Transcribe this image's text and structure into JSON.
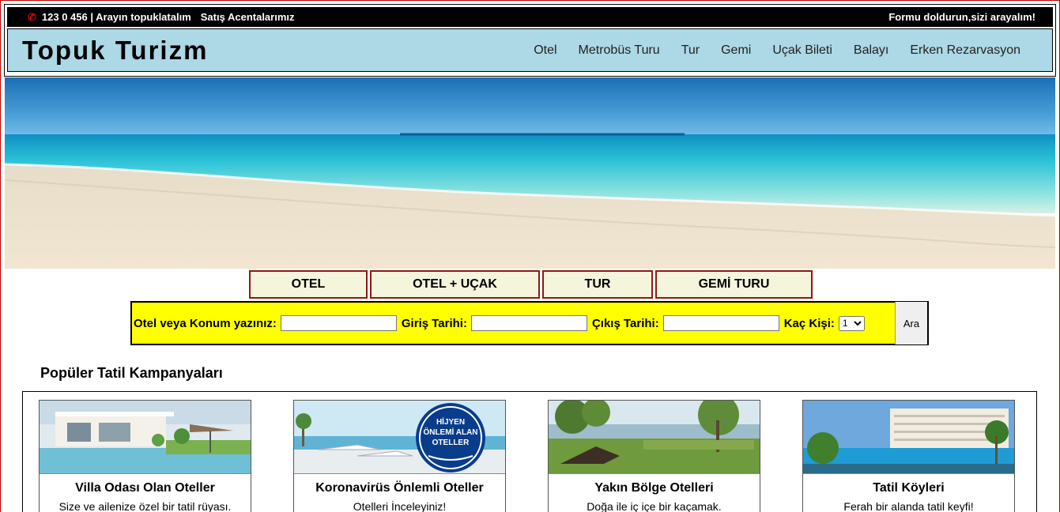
{
  "topbar": {
    "contact": "123 0 456 | Arayın topuklatalım",
    "agents": "Satış Acentalarımız",
    "callback": "Formu doldurun,sizi arayalım!"
  },
  "brand": "Topuk Turizm",
  "nav": [
    "Otel",
    "Metrobüs Turu",
    "Tur",
    "Gemi",
    "Uçak Bileti",
    "Balayı",
    "Erken Rezarvasyon"
  ],
  "tabs": [
    "OTEL",
    "OTEL + UÇAK",
    "TUR",
    "GEMİ TURU"
  ],
  "search": {
    "location_label": "Otel veya Konum yazınız:",
    "checkin_label": "Giriş Tarihi:",
    "checkout_label": "Çıkış Tarihi:",
    "guests_label": "Kaç Kişi:",
    "guests_value": "1",
    "button": "Ara"
  },
  "section_title": "Popüler Tatil Kampanyaları",
  "cards": [
    {
      "title": "Villa Odası Olan Oteller",
      "desc": "Size ve ailenize özel bir tatil rüyası."
    },
    {
      "title": "Koronavirüs Önlemli Oteller",
      "desc": "Otelleri İnceleyiniz!",
      "badge": [
        "HİJYEN",
        "ÖNLEMİ ALAN",
        "OTELLER"
      ]
    },
    {
      "title": "Yakın Bölge Otelleri",
      "desc": "Doğa ile iç içe bir kaçamak."
    },
    {
      "title": "Tatil Köyleri",
      "desc": "Ferah bir alanda tatil keyfi!"
    }
  ]
}
